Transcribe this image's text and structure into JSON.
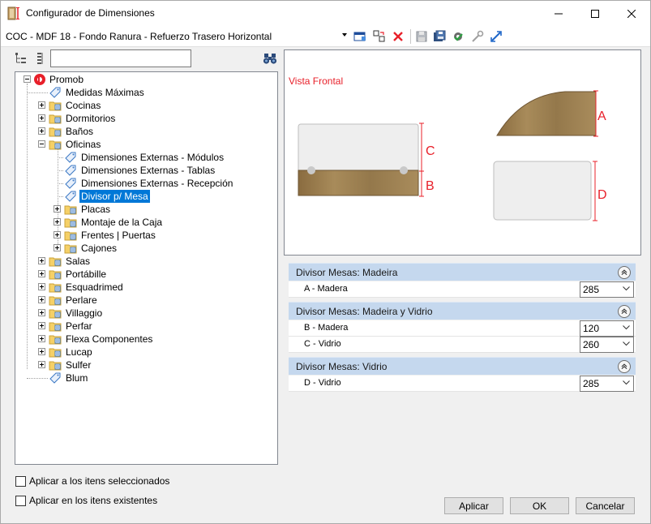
{
  "window": {
    "title": "Configurador de Dimensiones"
  },
  "toolbar": {
    "config_name": "COC - MDF 18 - Fondo Ranura - Refuerzo Trasero Horizontal",
    "icons": [
      "dropdown-caret",
      "window-icon",
      "copy-icon",
      "delete-icon",
      "save-icon",
      "save-all-icon",
      "settings-icon",
      "tools-icon",
      "arrows-icon"
    ]
  },
  "search": {
    "value": "",
    "placeholder": ""
  },
  "tree": {
    "root": "Promob",
    "items": [
      {
        "label": "Medidas Máximas"
      },
      {
        "label": "Cocinas"
      },
      {
        "label": "Dormitorios"
      },
      {
        "label": "Baños"
      },
      {
        "label": "Oficinas"
      },
      {
        "label": "Dimensiones Externas - Módulos"
      },
      {
        "label": "Dimensiones Externas - Tablas"
      },
      {
        "label": "Dimensiones Externas - Recepción"
      },
      {
        "label": "Divisor p/ Mesa"
      },
      {
        "label": "Placas"
      },
      {
        "label": "Montaje de la Caja"
      },
      {
        "label": "Frentes | Puertas"
      },
      {
        "label": "Cajones"
      },
      {
        "label": "Salas"
      },
      {
        "label": "Portábille"
      },
      {
        "label": "Esquadrimed"
      },
      {
        "label": "Perlare"
      },
      {
        "label": "Villaggio"
      },
      {
        "label": "Perfar"
      },
      {
        "label": "Flexa Componentes"
      },
      {
        "label": "Lucap"
      },
      {
        "label": "Sulfer"
      },
      {
        "label": "Blum"
      }
    ]
  },
  "preview": {
    "vista_label": "Vista Frontal",
    "dim_labels": {
      "a": "A",
      "b": "B",
      "c": "C",
      "d": "D"
    },
    "colors": {
      "accent": "#e8202a",
      "wood": "#9b7e4f"
    }
  },
  "groups": [
    {
      "title": "Divisor Mesas: Madeira",
      "rows": [
        {
          "label": "A - Madera",
          "value": "285"
        }
      ]
    },
    {
      "title": "Divisor Mesas: Madeira y Vidrio",
      "rows": [
        {
          "label": "B - Madera",
          "value": "120"
        },
        {
          "label": "C - Vidrio",
          "value": "260"
        }
      ]
    },
    {
      "title": "Divisor Mesas: Vidrio",
      "rows": [
        {
          "label": "D - Vidrio",
          "value": "285"
        }
      ]
    }
  ],
  "options": {
    "apply_selected": "Aplicar a los itens seleccionados",
    "apply_existing": "Aplicar en los itens existentes"
  },
  "buttons": {
    "apply": "Aplicar",
    "ok": "OK",
    "cancel": "Cancelar"
  }
}
